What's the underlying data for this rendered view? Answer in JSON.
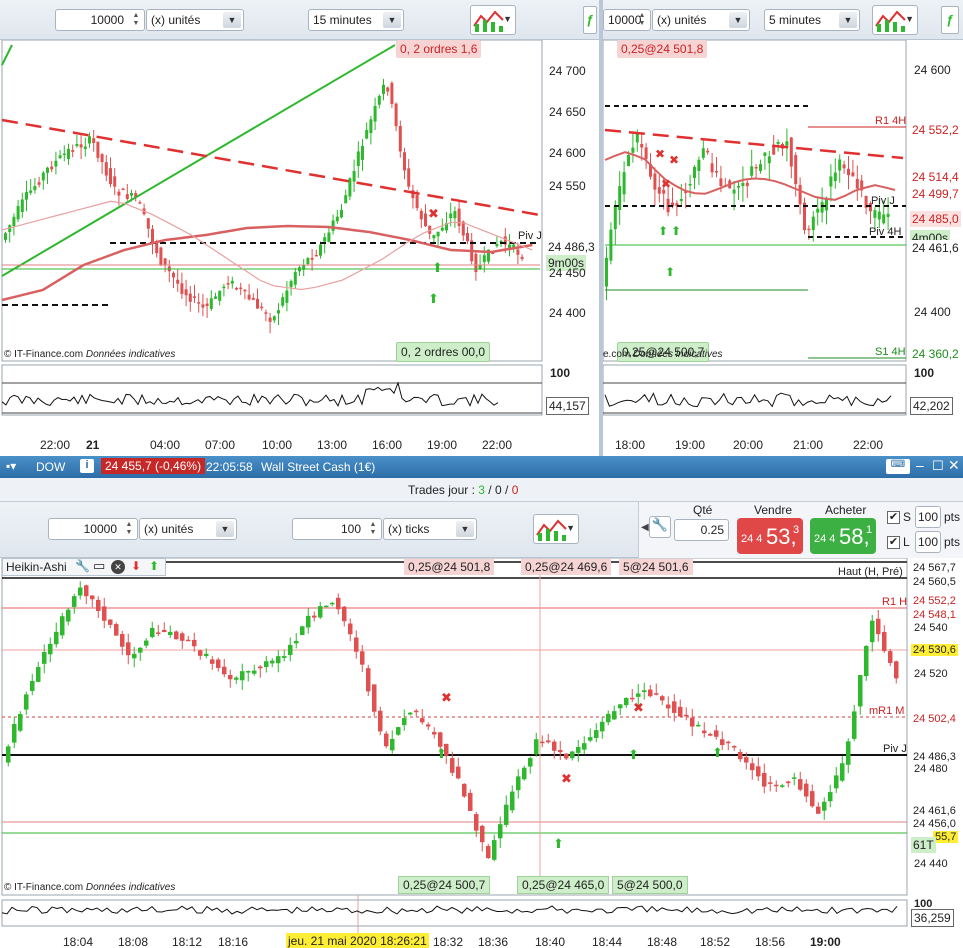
{
  "panel_left": {
    "quantity": "10000",
    "unit": "(x) unités",
    "interval": "15 minutes",
    "orders_top": "2 ordres",
    "orders_top_prefix": "0,",
    "orders_top_suffix": "1,6",
    "orders_bottom": "2 ordres",
    "orders_bottom_prefix": "0,",
    "orders_bottom_suffix": "00,0",
    "current_price": "24 486,3",
    "piv_label": "Piv J",
    "timer": "9m00s",
    "watermark": "© IT-Finance.com",
    "watermark_note": "Données indicatives",
    "osc_value": "44,157",
    "osc_level": "100",
    "y_ticks": [
      "24 700",
      "24 650",
      "24 600",
      "24 550",
      "24 450",
      "24 400"
    ],
    "x_ticks": [
      "22:00",
      "21",
      "04:00",
      "07:00",
      "10:00",
      "13:00",
      "16:00",
      "19:00",
      "22:00"
    ]
  },
  "panel_right": {
    "quantity": "10000",
    "unit": "(x) unités",
    "interval": "5 minutes",
    "order_top": "0,25@24 501,8",
    "order_bottom": "0,25@24 500,7",
    "watermark": "e.com",
    "watermark_note": "Données indicatives",
    "timer": "4m00s",
    "piv_j": "Piv J",
    "piv_4h": "Piv 4H",
    "r1_4h": "R1 4H",
    "s1_4h": "S1 4H",
    "osc_value": "42,202",
    "osc_level": "100",
    "price_tags": [
      "24 552,2",
      "24 514,4",
      "24 499,7",
      "24 485,0",
      "24 461,6",
      "24 360,2"
    ],
    "y_ticks": [
      "24 600",
      "24 400"
    ],
    "x_ticks": [
      "18:00",
      "19:00",
      "20:00",
      "21:00",
      "22:00"
    ]
  },
  "instrument": {
    "name": "DOW",
    "price_change": "24 455,7 (-0,46%)",
    "time": "22:05:58",
    "description": "Wall Street Cash (1€)"
  },
  "trades": {
    "label": "Trades jour :",
    "wins": "3",
    "sep1": "/",
    "zero1": "0",
    "sep2": "/",
    "zero2": "0"
  },
  "bottom_toolbar": {
    "quantity": "10000",
    "unit": "(x) unités",
    "ticks_value": "100",
    "ticks_unit": "(x) ticks",
    "qty_label": "Qté",
    "qty_value": "0.25",
    "sell_label": "Vendre",
    "buy_label": "Acheter",
    "sell_small": "24 4",
    "sell_big": "53,",
    "sell_sup": "3",
    "buy_small": "24 4",
    "buy_big": "58,",
    "buy_sup": "1",
    "stop_letter": "S",
    "limit_letter": "L",
    "stop_pts": "100",
    "limit_pts": "100",
    "pts_label": "pts"
  },
  "bottom_chart": {
    "indicator": "Heikin-Ashi",
    "orders": [
      "0,25@24 501,8",
      "0,25@24 469,6",
      "5@24 501,6"
    ],
    "orders_bottom": [
      "0,25@24 500,7",
      "0,25@24 465,0",
      "5@24 500,0"
    ],
    "haut_label": "Haut (H, Pré)",
    "r1h": "R1 H",
    "mr1m": "mR1 M",
    "pivj": "Piv J",
    "price_tags": [
      "24 567,7",
      "24 560,5",
      "24 552,2",
      "24 548,1",
      "24 530,6",
      "24 502,4",
      "24 486,3",
      "24 461,6",
      "24 456,0",
      "55,7"
    ],
    "y_ticks": [
      "24 540",
      "24 520",
      "24 480",
      "24 440"
    ],
    "timer": "61T",
    "watermark": "© IT-Finance.com",
    "watermark_note": "Données indicatives",
    "osc_value": "36,259",
    "osc_level": "100",
    "x_ticks": [
      "18:04",
      "18:08",
      "18:12",
      "18:16",
      "18:32",
      "18:36",
      "18:40",
      "18:44",
      "18:48",
      "18:52",
      "18:56",
      "19:00"
    ],
    "crosshair_date": "jeu. 21 mai 2020 18:26:21"
  },
  "colors": {
    "up": "#2db82d",
    "down": "#e05050",
    "accent_blue": "#2c6da8",
    "sell_red": "#e04848",
    "buy_green": "#3cb043"
  }
}
